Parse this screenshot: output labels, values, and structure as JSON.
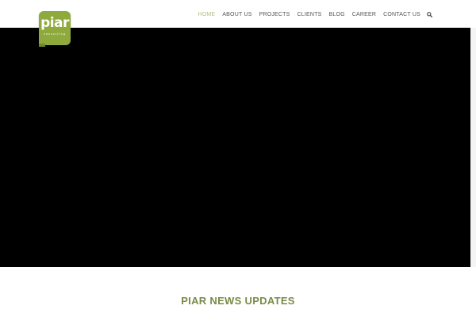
{
  "logo": {
    "name": "piar",
    "subtitle": "consulting"
  },
  "nav": {
    "items": [
      {
        "label": "HOME",
        "active": true
      },
      {
        "label": "ABOUT US",
        "active": false
      },
      {
        "label": "PROJECTS",
        "active": false
      },
      {
        "label": "CLIENTS",
        "active": false
      },
      {
        "label": "BLOG",
        "active": false
      },
      {
        "label": "CAREER",
        "active": false
      },
      {
        "label": "CONTACT US",
        "active": false
      }
    ],
    "search_icon": "search-icon"
  },
  "hero": {
    "background": "#000000"
  },
  "section": {
    "title": "PIAR NEWS UPDATES"
  },
  "colors": {
    "brand_green": "#8faa3c",
    "active_nav": "#b3bf7a",
    "title_green": "#7a8a48"
  }
}
